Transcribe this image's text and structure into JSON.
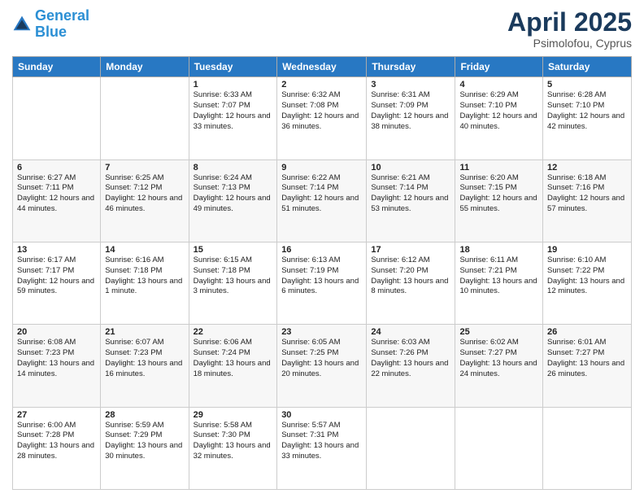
{
  "logo": {
    "line1": "General",
    "line2": "Blue"
  },
  "header": {
    "month": "April 2025",
    "location": "Psimolofou, Cyprus"
  },
  "weekdays": [
    "Sunday",
    "Monday",
    "Tuesday",
    "Wednesday",
    "Thursday",
    "Friday",
    "Saturday"
  ],
  "weeks": [
    [
      {
        "day": "",
        "sunrise": "",
        "sunset": "",
        "daylight": ""
      },
      {
        "day": "",
        "sunrise": "",
        "sunset": "",
        "daylight": ""
      },
      {
        "day": "1",
        "sunrise": "Sunrise: 6:33 AM",
        "sunset": "Sunset: 7:07 PM",
        "daylight": "Daylight: 12 hours and 33 minutes."
      },
      {
        "day": "2",
        "sunrise": "Sunrise: 6:32 AM",
        "sunset": "Sunset: 7:08 PM",
        "daylight": "Daylight: 12 hours and 36 minutes."
      },
      {
        "day": "3",
        "sunrise": "Sunrise: 6:31 AM",
        "sunset": "Sunset: 7:09 PM",
        "daylight": "Daylight: 12 hours and 38 minutes."
      },
      {
        "day": "4",
        "sunrise": "Sunrise: 6:29 AM",
        "sunset": "Sunset: 7:10 PM",
        "daylight": "Daylight: 12 hours and 40 minutes."
      },
      {
        "day": "5",
        "sunrise": "Sunrise: 6:28 AM",
        "sunset": "Sunset: 7:10 PM",
        "daylight": "Daylight: 12 hours and 42 minutes."
      }
    ],
    [
      {
        "day": "6",
        "sunrise": "Sunrise: 6:27 AM",
        "sunset": "Sunset: 7:11 PM",
        "daylight": "Daylight: 12 hours and 44 minutes."
      },
      {
        "day": "7",
        "sunrise": "Sunrise: 6:25 AM",
        "sunset": "Sunset: 7:12 PM",
        "daylight": "Daylight: 12 hours and 46 minutes."
      },
      {
        "day": "8",
        "sunrise": "Sunrise: 6:24 AM",
        "sunset": "Sunset: 7:13 PM",
        "daylight": "Daylight: 12 hours and 49 minutes."
      },
      {
        "day": "9",
        "sunrise": "Sunrise: 6:22 AM",
        "sunset": "Sunset: 7:14 PM",
        "daylight": "Daylight: 12 hours and 51 minutes."
      },
      {
        "day": "10",
        "sunrise": "Sunrise: 6:21 AM",
        "sunset": "Sunset: 7:14 PM",
        "daylight": "Daylight: 12 hours and 53 minutes."
      },
      {
        "day": "11",
        "sunrise": "Sunrise: 6:20 AM",
        "sunset": "Sunset: 7:15 PM",
        "daylight": "Daylight: 12 hours and 55 minutes."
      },
      {
        "day": "12",
        "sunrise": "Sunrise: 6:18 AM",
        "sunset": "Sunset: 7:16 PM",
        "daylight": "Daylight: 12 hours and 57 minutes."
      }
    ],
    [
      {
        "day": "13",
        "sunrise": "Sunrise: 6:17 AM",
        "sunset": "Sunset: 7:17 PM",
        "daylight": "Daylight: 12 hours and 59 minutes."
      },
      {
        "day": "14",
        "sunrise": "Sunrise: 6:16 AM",
        "sunset": "Sunset: 7:18 PM",
        "daylight": "Daylight: 13 hours and 1 minute."
      },
      {
        "day": "15",
        "sunrise": "Sunrise: 6:15 AM",
        "sunset": "Sunset: 7:18 PM",
        "daylight": "Daylight: 13 hours and 3 minutes."
      },
      {
        "day": "16",
        "sunrise": "Sunrise: 6:13 AM",
        "sunset": "Sunset: 7:19 PM",
        "daylight": "Daylight: 13 hours and 6 minutes."
      },
      {
        "day": "17",
        "sunrise": "Sunrise: 6:12 AM",
        "sunset": "Sunset: 7:20 PM",
        "daylight": "Daylight: 13 hours and 8 minutes."
      },
      {
        "day": "18",
        "sunrise": "Sunrise: 6:11 AM",
        "sunset": "Sunset: 7:21 PM",
        "daylight": "Daylight: 13 hours and 10 minutes."
      },
      {
        "day": "19",
        "sunrise": "Sunrise: 6:10 AM",
        "sunset": "Sunset: 7:22 PM",
        "daylight": "Daylight: 13 hours and 12 minutes."
      }
    ],
    [
      {
        "day": "20",
        "sunrise": "Sunrise: 6:08 AM",
        "sunset": "Sunset: 7:23 PM",
        "daylight": "Daylight: 13 hours and 14 minutes."
      },
      {
        "day": "21",
        "sunrise": "Sunrise: 6:07 AM",
        "sunset": "Sunset: 7:23 PM",
        "daylight": "Daylight: 13 hours and 16 minutes."
      },
      {
        "day": "22",
        "sunrise": "Sunrise: 6:06 AM",
        "sunset": "Sunset: 7:24 PM",
        "daylight": "Daylight: 13 hours and 18 minutes."
      },
      {
        "day": "23",
        "sunrise": "Sunrise: 6:05 AM",
        "sunset": "Sunset: 7:25 PM",
        "daylight": "Daylight: 13 hours and 20 minutes."
      },
      {
        "day": "24",
        "sunrise": "Sunrise: 6:03 AM",
        "sunset": "Sunset: 7:26 PM",
        "daylight": "Daylight: 13 hours and 22 minutes."
      },
      {
        "day": "25",
        "sunrise": "Sunrise: 6:02 AM",
        "sunset": "Sunset: 7:27 PM",
        "daylight": "Daylight: 13 hours and 24 minutes."
      },
      {
        "day": "26",
        "sunrise": "Sunrise: 6:01 AM",
        "sunset": "Sunset: 7:27 PM",
        "daylight": "Daylight: 13 hours and 26 minutes."
      }
    ],
    [
      {
        "day": "27",
        "sunrise": "Sunrise: 6:00 AM",
        "sunset": "Sunset: 7:28 PM",
        "daylight": "Daylight: 13 hours and 28 minutes."
      },
      {
        "day": "28",
        "sunrise": "Sunrise: 5:59 AM",
        "sunset": "Sunset: 7:29 PM",
        "daylight": "Daylight: 13 hours and 30 minutes."
      },
      {
        "day": "29",
        "sunrise": "Sunrise: 5:58 AM",
        "sunset": "Sunset: 7:30 PM",
        "daylight": "Daylight: 13 hours and 32 minutes."
      },
      {
        "day": "30",
        "sunrise": "Sunrise: 5:57 AM",
        "sunset": "Sunset: 7:31 PM",
        "daylight": "Daylight: 13 hours and 33 minutes."
      },
      {
        "day": "",
        "sunrise": "",
        "sunset": "",
        "daylight": ""
      },
      {
        "day": "",
        "sunrise": "",
        "sunset": "",
        "daylight": ""
      },
      {
        "day": "",
        "sunrise": "",
        "sunset": "",
        "daylight": ""
      }
    ]
  ]
}
